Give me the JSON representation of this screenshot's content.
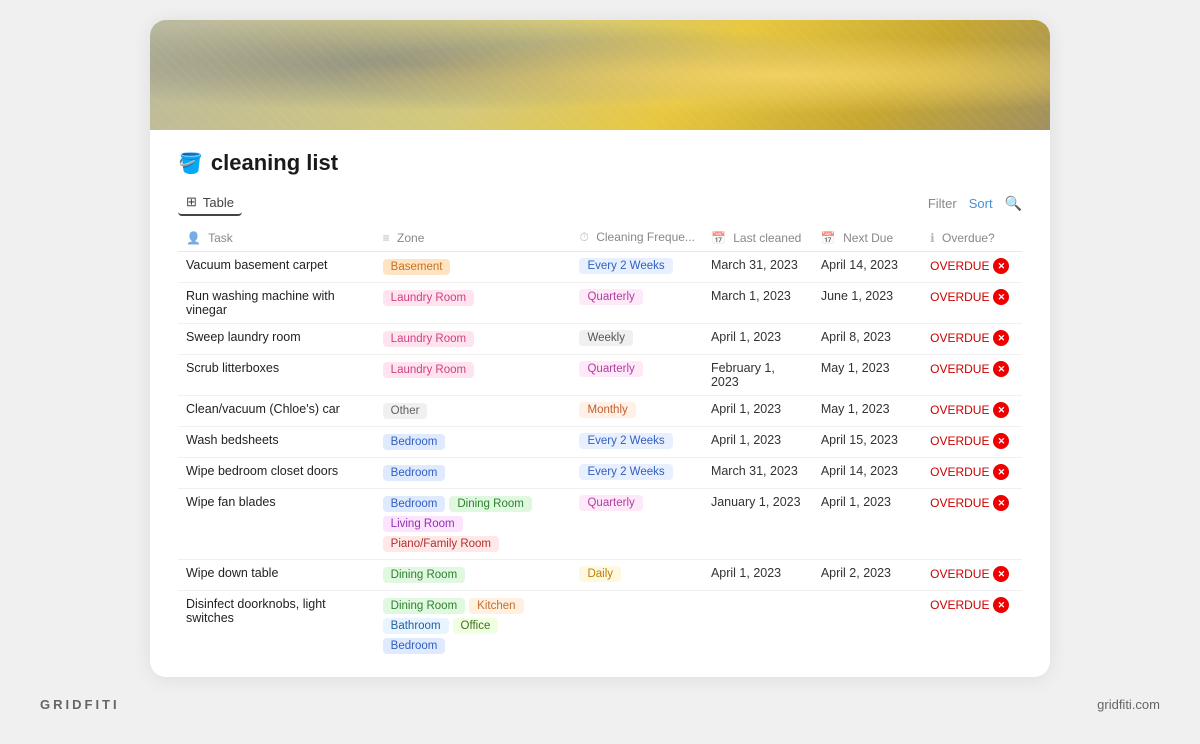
{
  "page": {
    "icon": "🪣",
    "title": "cleaning list",
    "cover_alt": "sponge cleaning image"
  },
  "toolbar": {
    "view_label": "Table",
    "filter_label": "Filter",
    "sort_label": "Sort"
  },
  "table": {
    "headers": [
      {
        "key": "task",
        "label": "Task",
        "icon": "👤"
      },
      {
        "key": "zone",
        "label": "Zone",
        "icon": "≡"
      },
      {
        "key": "freq",
        "label": "Cleaning Freque...",
        "icon": "⏱"
      },
      {
        "key": "last",
        "label": "Last cleaned",
        "icon": "📅"
      },
      {
        "key": "next",
        "label": "Next Due",
        "icon": "📅"
      },
      {
        "key": "overdue",
        "label": "Overdue?",
        "icon": "ℹ"
      }
    ],
    "rows": [
      {
        "task": "Vacuum basement carpet",
        "zones": [
          {
            "label": "Basement",
            "class": "tag-basement"
          }
        ],
        "freq": {
          "label": "Every 2 Weeks",
          "class": "freq-every2"
        },
        "last": "March 31, 2023",
        "next": "April 14, 2023",
        "overdue": true
      },
      {
        "task": "Run washing machine with vinegar",
        "zones": [
          {
            "label": "Laundry Room",
            "class": "tag-laundry"
          }
        ],
        "freq": {
          "label": "Quarterly",
          "class": "freq-quarterly"
        },
        "last": "March 1, 2023",
        "next": "June 1, 2023",
        "overdue": true
      },
      {
        "task": "Sweep laundry room",
        "zones": [
          {
            "label": "Laundry Room",
            "class": "tag-laundry"
          }
        ],
        "freq": {
          "label": "Weekly",
          "class": "freq-weekly"
        },
        "last": "April 1, 2023",
        "next": "April 8, 2023",
        "overdue": true
      },
      {
        "task": "Scrub litterboxes",
        "zones": [
          {
            "label": "Laundry Room",
            "class": "tag-laundry"
          }
        ],
        "freq": {
          "label": "Quarterly",
          "class": "freq-quarterly"
        },
        "last": "February 1, 2023",
        "next": "May 1, 2023",
        "overdue": true
      },
      {
        "task": "Clean/vacuum (Chloe's) car",
        "zones": [
          {
            "label": "Other",
            "class": "tag-other"
          }
        ],
        "freq": {
          "label": "Monthly",
          "class": "freq-monthly"
        },
        "last": "April 1, 2023",
        "next": "May 1, 2023",
        "overdue": true
      },
      {
        "task": "Wash bedsheets",
        "zones": [
          {
            "label": "Bedroom",
            "class": "tag-bedroom"
          }
        ],
        "freq": {
          "label": "Every 2 Weeks",
          "class": "freq-every2"
        },
        "last": "April 1, 2023",
        "next": "April 15, 2023",
        "overdue": true
      },
      {
        "task": "Wipe bedroom closet doors",
        "zones": [
          {
            "label": "Bedroom",
            "class": "tag-bedroom"
          }
        ],
        "freq": {
          "label": "Every 2 Weeks",
          "class": "freq-every2"
        },
        "last": "March 31, 2023",
        "next": "April 14, 2023",
        "overdue": true
      },
      {
        "task": "Wipe fan blades",
        "zones": [
          {
            "label": "Bedroom",
            "class": "tag-bedroom"
          },
          {
            "label": "Dining Room",
            "class": "tag-dining"
          },
          {
            "label": "Living Room",
            "class": "tag-living"
          },
          {
            "label": "Piano/Family Room",
            "class": "tag-piano"
          }
        ],
        "freq": {
          "label": "Quarterly",
          "class": "freq-quarterly"
        },
        "last": "January 1, 2023",
        "next": "April 1, 2023",
        "overdue": true
      },
      {
        "task": "Wipe down table",
        "zones": [
          {
            "label": "Dining Room",
            "class": "tag-dining"
          }
        ],
        "freq": {
          "label": "Daily",
          "class": "freq-daily"
        },
        "last": "April 1, 2023",
        "next": "April 2, 2023",
        "overdue": true
      },
      {
        "task": "Disinfect doorknobs, light switches",
        "zones": [
          {
            "label": "Dining Room",
            "class": "tag-dining"
          },
          {
            "label": "Kitchen",
            "class": "tag-kitchen"
          },
          {
            "label": "Bathroom",
            "class": "tag-bathroom"
          },
          {
            "label": "Office",
            "class": "tag-office"
          },
          {
            "label": "Bedroom",
            "class": "tag-bedroom"
          }
        ],
        "freq": {
          "label": "",
          "class": ""
        },
        "last": "",
        "next": "",
        "overdue": true
      }
    ]
  },
  "footer": {
    "brand_left": "GRIDFITI",
    "brand_right": "gridfiti.com"
  }
}
